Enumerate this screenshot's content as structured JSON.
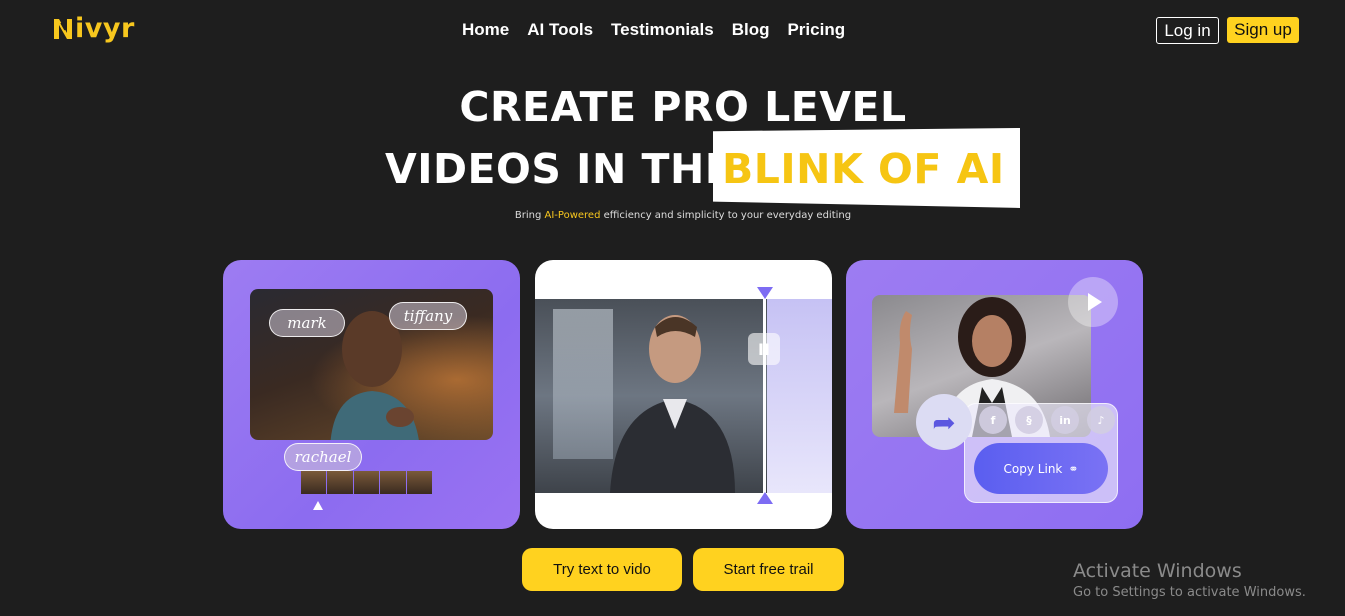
{
  "header": {
    "logo_text": "ivyr",
    "nav": [
      "Home",
      "AI Tools",
      "Testimonials",
      "Blog",
      "Pricing"
    ],
    "login_label": "Log in",
    "signup_label": "Sign up"
  },
  "hero": {
    "line1": "CREATE PRO LEVEL",
    "line2_prefix": "VIDEOS IN THE",
    "line2_highlight": "BLINK OF AI",
    "subtitle_pre": "Bring ",
    "subtitle_accent": "AI-Powered",
    "subtitle_post": " efficiency and simplicity to your everyday editing"
  },
  "cards": {
    "card1": {
      "tags": [
        "mark",
        "tiffany",
        "rachael"
      ]
    },
    "card2": {
      "handle_icon": "pause-icon"
    },
    "card3": {
      "copy_link_label": "Copy Link",
      "socials": [
        "facebook-icon",
        "link-icon",
        "linkedin-icon",
        "tiktok-icon"
      ]
    }
  },
  "cta": {
    "primary": "Try text to vido",
    "secondary": "Start free trail"
  },
  "watermark": {
    "title": "Activate Windows",
    "subtitle": "Go to Settings to activate Windows."
  },
  "colors": {
    "background": "#1e1e1e",
    "accent_yellow": "#ffd21f",
    "card_purple": "#9a7cf2"
  }
}
